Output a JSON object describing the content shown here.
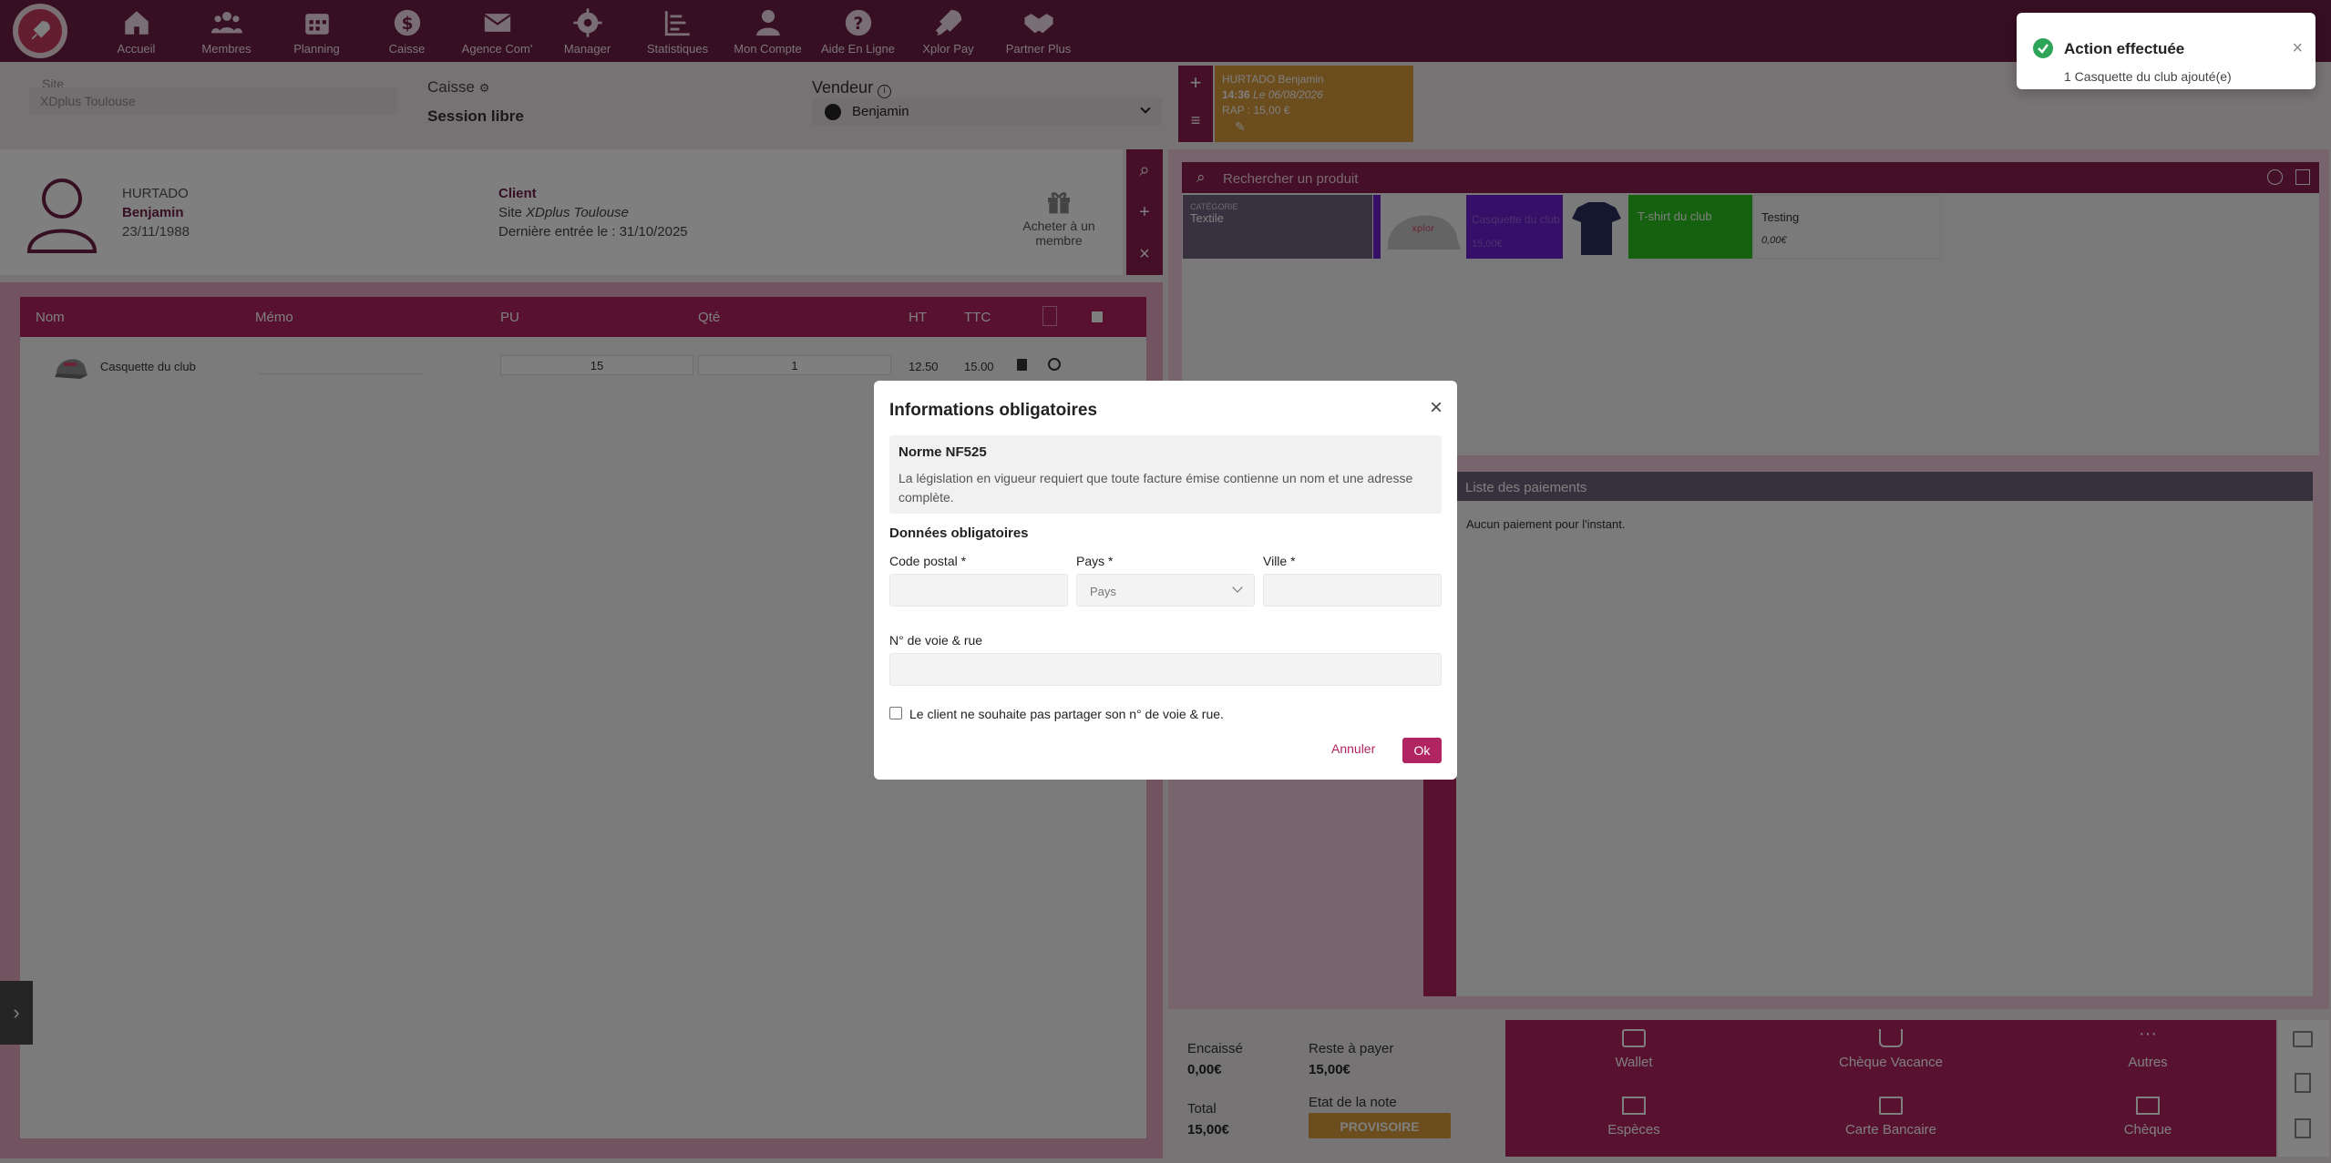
{
  "nav": {
    "items": [
      {
        "label": "Accueil",
        "icon": "home-icon"
      },
      {
        "label": "Membres",
        "icon": "members-icon"
      },
      {
        "label": "Planning",
        "icon": "calendar-icon"
      },
      {
        "label": "Caisse",
        "icon": "dollar-icon"
      },
      {
        "label": "Agence Com'",
        "icon": "mail-icon"
      },
      {
        "label": "Manager",
        "icon": "gear-icon"
      },
      {
        "label": "Statistiques",
        "icon": "stats-icon"
      },
      {
        "label": "Mon Compte",
        "icon": "user-icon"
      },
      {
        "label": "Aide En Ligne",
        "icon": "help-icon"
      },
      {
        "label": "Xplor Pay",
        "icon": "rocket-icon"
      },
      {
        "label": "Partner Plus",
        "icon": "handshake-icon"
      }
    ]
  },
  "toast": {
    "title": "Action effectuée",
    "message": "1 Casquette du club ajouté(e)"
  },
  "header": {
    "site_label": "Site",
    "site_value": "XDplus Toulouse",
    "caisse_label": "Caisse",
    "caisse_session": "Session libre",
    "vendeur_label": "Vendeur",
    "vendeur_value": "Benjamin"
  },
  "pending": {
    "name": "HURTADO Benjamin",
    "time": "14:36",
    "date": "Le 06/08/2026",
    "rap": "RAP : 15,00 €"
  },
  "client": {
    "lastname": "HURTADO",
    "firstname": "Benjamin",
    "dob": "23/11/1988",
    "label": "Client",
    "site_prefix": "Site",
    "site": "XDplus Toulouse",
    "last_entry": "Dernière entrée le : 31/10/2025",
    "gift_label": "Acheter à un membre"
  },
  "order": {
    "headers": {
      "nom": "Nom",
      "memo": "Mémo",
      "pu": "PU",
      "qte": "Qté",
      "ht": "HT",
      "ttc": "TTC"
    },
    "rows": [
      {
        "name": "Casquette du club",
        "pu": "15",
        "qte": "1",
        "ht": "12.50",
        "ttc": "15.00"
      }
    ]
  },
  "products": {
    "search_placeholder": "Rechercher un produit",
    "category_label": "CATÉGORIE",
    "category_name": "Textile",
    "tiles": [
      {
        "name": "Casquette du club",
        "price": "15,00€"
      },
      {
        "name": "T-shirt du club",
        "price": ""
      },
      {
        "name": "Testing",
        "price": "0,00€"
      }
    ]
  },
  "payments": {
    "title": "Liste des paiements",
    "empty": "Aucun paiement pour l'instant."
  },
  "totals": {
    "encaisse_label": "Encaissé",
    "encaisse_value": "0,00€",
    "reste_label": "Reste à payer",
    "reste_value": "15,00€",
    "total_label": "Total",
    "total_value": "15,00€",
    "etat_label": "Etat de la note",
    "etat_value": "PROVISOIRE"
  },
  "pay_methods": [
    "Wallet",
    "Chèque Vacance",
    "Autres",
    "Espèces",
    "Carte Bancaire",
    "Chèque"
  ],
  "modal": {
    "title": "Informations obligatoires",
    "norm_title": "Norme NF525",
    "norm_text": "La législation en vigueur requiert que toute facture émise contienne un nom et une adresse complète.",
    "section": "Données obligatoires",
    "postal_label": "Code postal *",
    "country_label": "Pays *",
    "country_placeholder": "Pays",
    "city_label": "Ville *",
    "street_label": "N° de voie & rue",
    "checkbox_label": "Le client ne souhaite pas partager son n° de voie & rue.",
    "cancel": "Annuler",
    "ok": "Ok"
  },
  "colors": {
    "brand": "#6e1f45",
    "accent": "#b02461",
    "warning": "#d89b3c",
    "success": "#2da559"
  }
}
